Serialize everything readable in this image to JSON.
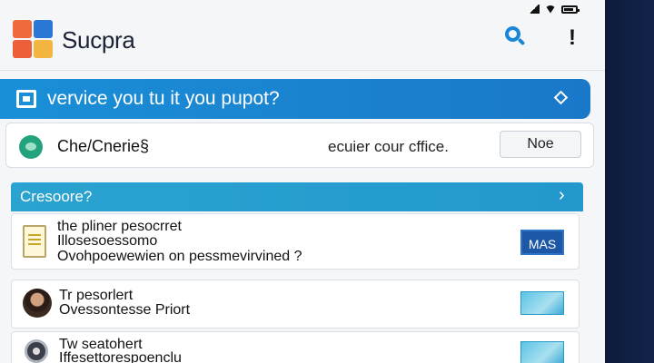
{
  "app": {
    "brand": "Sucpra"
  },
  "header": {
    "search_icon": "search-icon",
    "alert_symbol": "!"
  },
  "banner": {
    "text": "vervice you tu it you pupot?",
    "icon": "window-icon",
    "action_icon": "diamond-icon"
  },
  "notice": {
    "title": "Che/Cnerie§",
    "message": "ecuier cour cffice.",
    "button_label": "Noe"
  },
  "section": {
    "title": "Cresoore?",
    "chevron": "›"
  },
  "rows": [
    {
      "line1": "the pliner pesocrret",
      "line2": "Illosesoessomo",
      "line3": "Ovohpoewewien on pessmevirvined ?",
      "badge": "MAS",
      "icon": "document-icon"
    },
    {
      "line1": "Tr pesorlert",
      "line2": "Ovessontesse Priort",
      "icon": "avatar"
    },
    {
      "line1": "Tw seatohert",
      "line2": "Iffesettorespoenclu",
      "icon": "gear-icon"
    }
  ],
  "colors": {
    "accent": "#1a86d8",
    "banner": "#1a8fd8",
    "section": "#2aa3d1",
    "badge": "#1d58a6",
    "status_green": "#23a27e"
  }
}
